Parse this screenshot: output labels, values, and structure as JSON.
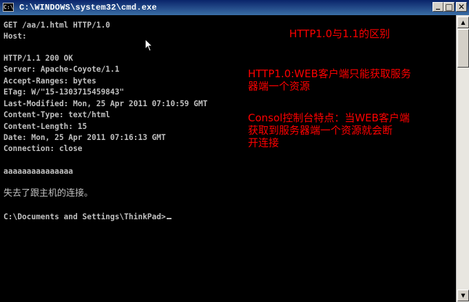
{
  "window": {
    "title": "C:\\WINDOWS\\system32\\cmd.exe",
    "icon": "cmd-icon",
    "icon_glyph": "C:\\",
    "buttons": {
      "minimize": "_",
      "maximize": "□",
      "close": "✕"
    }
  },
  "console": {
    "lines": [
      "GET /aa/1.html HTTP/1.0",
      "Host:",
      "",
      "HTTP/1.1 200 OK",
      "Server: Apache-Coyote/1.1",
      "Accept-Ranges: bytes",
      "ETag: W/\"15-1303715459843\"",
      "Last-Modified: Mon, 25 Apr 2011 07:10:59 GMT",
      "Content-Type: text/html",
      "Content-Length: 15",
      "Date: Mon, 25 Apr 2011 07:16:13 GMT",
      "Connection: close",
      "",
      "aaaaaaaaaaaaaaa",
      "",
      "失去了跟主机的连接。",
      "",
      "C:\\Documents and Settings\\ThinkPad>"
    ]
  },
  "annotations": {
    "title": "HTTP1.0与1.1的区别",
    "http10": "HTTP1.0:WEB客户端只能获取服务\n器端一个资源",
    "console_note": "Consol控制台特点：当WEB客户端\n获取到服务器端一个资源就会断\n开连接"
  },
  "colors": {
    "console_text": "#c0c0c0",
    "console_bg": "#000000",
    "annotation": "#ff0000",
    "titlebar": "#0a246a"
  }
}
